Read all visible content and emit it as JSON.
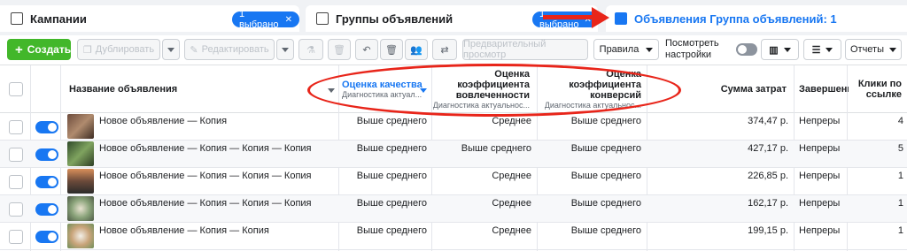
{
  "tabs": {
    "campaigns": {
      "label": "Кампании",
      "selected": "1 выбрано"
    },
    "adsets": {
      "label": "Группы объявлений",
      "selected": "1 выбрано"
    },
    "ads": {
      "label": "Объявления Группа объявлений: 1"
    }
  },
  "toolbar": {
    "create": "Создать",
    "duplicate": "Дублировать",
    "edit": "Редактировать",
    "preview": "Предварительный просмотр",
    "rules": "Правила",
    "view_settings_line1": "Посмотреть",
    "view_settings_line2": "настройки",
    "reports": "Отчеты"
  },
  "columns": {
    "name": "Название объявления",
    "quality": "Оценка качества",
    "quality_sub": "Диагностика актуал...",
    "engagement_l1": "Оценка",
    "engagement_l2": "коэффициента",
    "engagement_l3": "вовлеченности",
    "engagement_sub": "Диагностика актуальнос...",
    "conversion_l1": "Оценка",
    "conversion_l2": "коэффициента",
    "conversion_l3": "конверсий",
    "conversion_sub": "Диагностика актуальнос...",
    "spend": "Сумма затрат",
    "ends": "Завершени",
    "clicks_l1": "Клики по",
    "clicks_l2": "ссылке"
  },
  "rows": [
    {
      "name": "Новое объявление — Копия",
      "quality": "Выше среднего",
      "engagement": "Среднее",
      "conversion": "Выше среднего",
      "spend": "374,47 р.",
      "ends": "Непреры",
      "clicks": "4"
    },
    {
      "name": "Новое объявление — Копия — Копия — Копия",
      "quality": "Выше среднего",
      "engagement": "Выше среднего",
      "conversion": "Выше среднего",
      "spend": "427,17 р.",
      "ends": "Непреры",
      "clicks": "5"
    },
    {
      "name": "Новое объявление — Копия — Копия — Копия",
      "quality": "Выше среднего",
      "engagement": "Среднее",
      "conversion": "Выше среднего",
      "spend": "226,85 р.",
      "ends": "Непреры",
      "clicks": "1"
    },
    {
      "name": "Новое объявление — Копия — Копия — Копия",
      "quality": "Выше среднего",
      "engagement": "Среднее",
      "conversion": "Выше среднего",
      "spend": "162,17 р.",
      "ends": "Непреры",
      "clicks": "1"
    },
    {
      "name": "Новое объявление — Копия — Копия",
      "quality": "Выше среднего",
      "engagement": "Среднее",
      "conversion": "Выше среднего",
      "spend": "199,15 р.",
      "ends": "Непреры",
      "clicks": "1"
    }
  ],
  "colors": {
    "accent": "#1877f2",
    "create": "#42b72a",
    "annotation": "#e8251a"
  }
}
